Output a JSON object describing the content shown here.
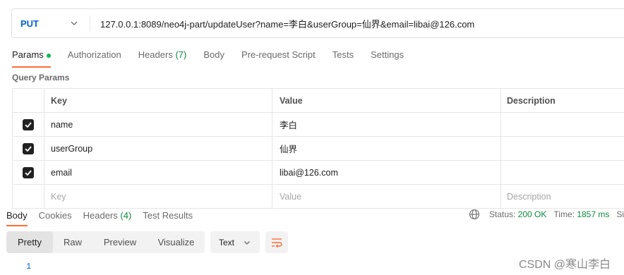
{
  "request": {
    "method": "PUT",
    "url": "127.0.0.1:8089/neo4j-part/updateUser?name=李白&userGroup=仙界&email=libai@126.com"
  },
  "request_tabs": [
    {
      "label": "Params",
      "active": true
    },
    {
      "label": "Authorization"
    },
    {
      "label": "Headers",
      "count": "(7)"
    },
    {
      "label": "Body"
    },
    {
      "label": "Pre-request Script"
    },
    {
      "label": "Tests"
    },
    {
      "label": "Settings"
    }
  ],
  "query_params": {
    "title": "Query Params",
    "headers": [
      "Key",
      "Value",
      "Description"
    ],
    "rows": [
      {
        "checked": true,
        "key": "name",
        "value": "李白",
        "description": ""
      },
      {
        "checked": true,
        "key": "userGroup",
        "value": "仙界",
        "description": ""
      },
      {
        "checked": true,
        "key": "email",
        "value": "libai@126.com",
        "description": ""
      }
    ],
    "placeholders": {
      "key": "Key",
      "value": "Value",
      "description": "Description"
    }
  },
  "response_tabs": [
    {
      "label": "Body",
      "active": true
    },
    {
      "label": "Cookies"
    },
    {
      "label": "Headers",
      "count": "(4)"
    },
    {
      "label": "Test Results"
    }
  ],
  "status": {
    "status_label": "Status:",
    "status_value": "200 OK",
    "time_label": "Time:",
    "time_value": "1857 ms",
    "size_label_cut": "Si"
  },
  "view_modes": [
    "Pretty",
    "Raw",
    "Preview",
    "Visualize"
  ],
  "active_view": "Pretty",
  "format_select": "Text",
  "body_line_number": "1",
  "watermark": "CSDN @寒山李白",
  "colors": {
    "accent": "#ff6c37",
    "method": "#0265d2",
    "success": "#0c8a3f",
    "dot": "#0cbb52"
  },
  "icons": [
    "chevron-down-icon",
    "checkbox-checked-icon",
    "globe-icon",
    "wrap-lines-icon"
  ]
}
